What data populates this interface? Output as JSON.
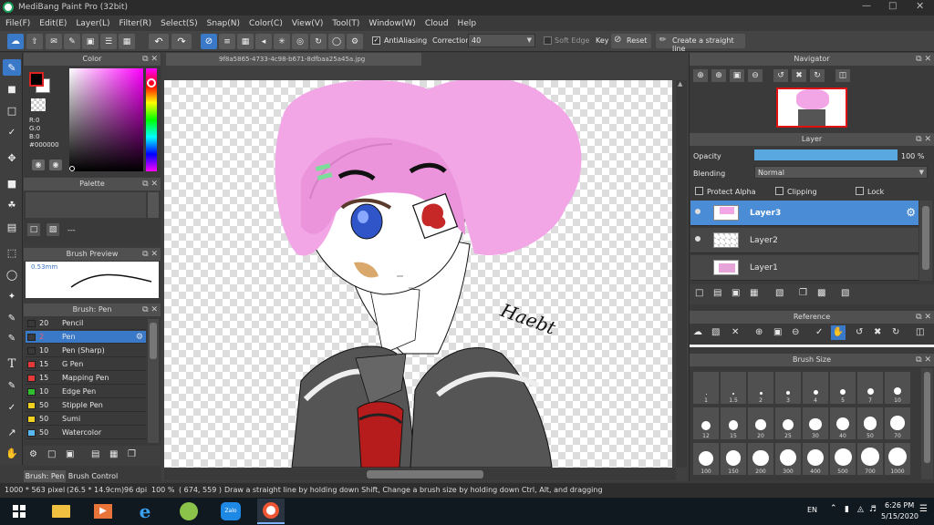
{
  "window": {
    "title": "MediBang Paint Pro (32bit)"
  },
  "menu": [
    "File(F)",
    "Edit(E)",
    "Layer(L)",
    "Filter(R)",
    "Select(S)",
    "Snap(N)",
    "Color(C)",
    "View(V)",
    "Tool(T)",
    "Window(W)",
    "Cloud",
    "Help"
  ],
  "toolbar": {
    "antialiasing": "AntiAliasing",
    "correction_label": "Correction",
    "correction_value": "40",
    "soft_edge": "Soft Edge",
    "key": "Key",
    "reset": "Reset",
    "straight_line": "Create a straight line"
  },
  "document_tab": "9f8a5865-4733-4c98-b671-8dfbaa25a45a.jpg",
  "color_panel": {
    "title": "Color",
    "r": "R:0",
    "g": "G:0",
    "b": "B:0",
    "hex": "#000000",
    "primary": "#000000",
    "secondary": "#ffffff",
    "hue": "#ff00ff"
  },
  "palette_panel": {
    "title": "Palette",
    "placeholder": "---"
  },
  "brush_preview": {
    "title": "Brush Preview",
    "size": "0.53mm"
  },
  "brush_panel": {
    "title": "Brush: Pen",
    "items": [
      {
        "size": "20",
        "name": "Pencil",
        "color": "#3a3a3a"
      },
      {
        "size": "2",
        "name": "Pen",
        "color": "#3a3a3a",
        "selected": true
      },
      {
        "size": "10",
        "name": "Pen (Sharp)",
        "color": "#3a3a3a"
      },
      {
        "size": "15",
        "name": "G Pen",
        "color": "#e53a3a"
      },
      {
        "size": "15",
        "name": "Mapping Pen",
        "color": "#e53a3a"
      },
      {
        "size": "10",
        "name": "Edge Pen",
        "color": "#2fbf2f"
      },
      {
        "size": "50",
        "name": "Stipple Pen",
        "color": "#f0d020"
      },
      {
        "size": "50",
        "name": "Sumi",
        "color": "#f0d020"
      },
      {
        "size": "50",
        "name": "Watercolor",
        "color": "#5ab8f0"
      }
    ],
    "tab1": "Brush: Pen",
    "tab2": "Brush Control"
  },
  "navigator": {
    "title": "Navigator"
  },
  "layer_panel": {
    "title": "Layer",
    "opacity_label": "Opacity",
    "opacity_value": "100 %",
    "opacity_fraction": 1.0,
    "blending_label": "Blending",
    "blending_value": "Normal",
    "protect_alpha": "Protect Alpha",
    "clipping": "Clipping",
    "lock": "Lock",
    "layers": [
      {
        "name": "Layer3",
        "selected": true
      },
      {
        "name": "Layer2",
        "selected": false
      },
      {
        "name": "Layer1",
        "selected": false
      }
    ]
  },
  "reference": {
    "title": "Reference"
  },
  "brush_size": {
    "title": "Brush Size",
    "sizes": [
      "1",
      "1.5",
      "2",
      "3",
      "4",
      "5",
      "7",
      "10",
      "12",
      "15",
      "20",
      "25",
      "30",
      "40",
      "50",
      "70",
      "100",
      "150",
      "200",
      "300",
      "400",
      "500",
      "700",
      "1000"
    ]
  },
  "status_bar": {
    "pixels": "1000 * 563 pixel",
    "cm": "(26.5 * 14.9cm)",
    "dpi": "96 dpi",
    "zoom": "100 %",
    "coords": "( 674, 559 )",
    "hint": "Draw a straight line by holding down Shift, Change a brush size by holding down Ctrl, Alt, and dragging"
  },
  "canvas_signature": "Haebt",
  "taskbar": {
    "lang": "EN",
    "time": "6:26 PM",
    "date": "5/15/2020",
    "zalo": "Zalo"
  }
}
